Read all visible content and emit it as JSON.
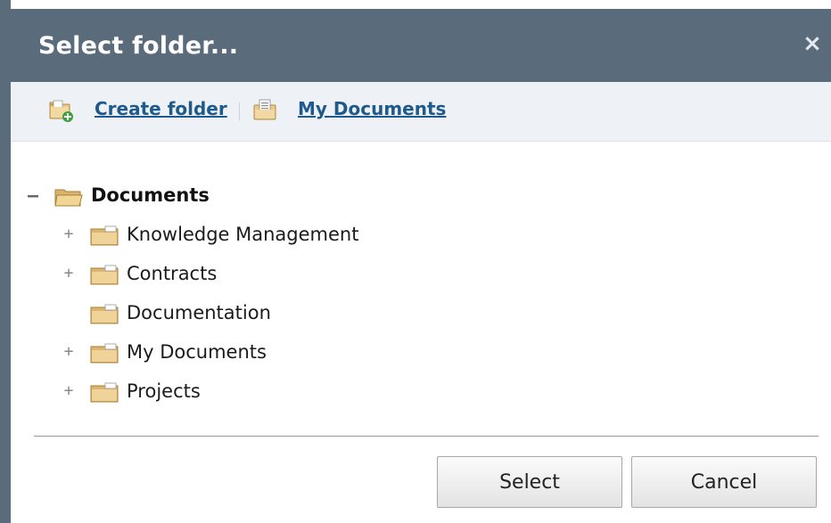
{
  "dialog": {
    "title": "Select folder...",
    "close_icon": "close-icon",
    "close_glyph": "×"
  },
  "toolbar": {
    "create_folder_label": "Create folder",
    "create_folder_icon": "folder-add-icon",
    "my_documents_label": "My Documents",
    "my_documents_icon": "documents-folder-icon"
  },
  "tree": {
    "root": {
      "label": "Documents",
      "expanded": true,
      "toggle": "–"
    },
    "children": [
      {
        "label": "Knowledge Management",
        "toggle": "+",
        "has_children": true
      },
      {
        "label": "Contracts",
        "toggle": "+",
        "has_children": true
      },
      {
        "label": "Documentation",
        "toggle": "",
        "has_children": false
      },
      {
        "label": "My Documents",
        "toggle": "+",
        "has_children": true
      },
      {
        "label": "Projects",
        "toggle": "+",
        "has_children": true
      }
    ]
  },
  "buttons": {
    "select_label": "Select",
    "cancel_label": "Cancel"
  },
  "colors": {
    "titlebar": "#5a6b7c",
    "link": "#1f5a8c",
    "toolbar_bg": "#eef2f6"
  }
}
